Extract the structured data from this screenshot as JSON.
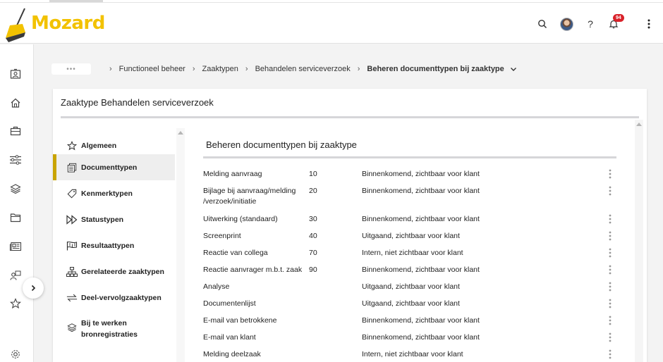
{
  "app": {
    "logo_text": "Mozard",
    "notification_count": "94",
    "help_label": "?"
  },
  "breadcrumb": {
    "more": "•••",
    "items": [
      "Functioneel beheer",
      "Zaaktypen",
      "Behandelen serviceverzoek"
    ],
    "current": "Beheren documenttypen bij zaaktype"
  },
  "card": {
    "title": "Zaaktype Behandelen serviceverzoek"
  },
  "nav": {
    "items": [
      {
        "label": "Algemeen",
        "icon": "star-icon"
      },
      {
        "label": "Documenttypen",
        "icon": "documents-icon",
        "active": true
      },
      {
        "label": "Kenmerktypen",
        "icon": "tag-icon"
      },
      {
        "label": "Statustypen",
        "icon": "fast-forward-icon"
      },
      {
        "label": "Resultaattypen",
        "icon": "flag-icon"
      },
      {
        "label": "Gerelateerde zaaktypen",
        "icon": "hierarchy-icon"
      },
      {
        "label": "Deel-vervolgzaaktypen",
        "icon": "exchange-icon"
      },
      {
        "label": "Bij te werken\nbronregistraties",
        "icon": "layers-icon"
      }
    ]
  },
  "section": {
    "title": "Beheren documenttypen bij zaaktype"
  },
  "documents": [
    {
      "name": "Melding aanvraag",
      "code": "10",
      "type": "Binnenkomend, zichtbaar voor klant"
    },
    {
      "name": "Bijlage bij aanvraag/melding\n/verzoek/initiatie",
      "code": "20",
      "type": "Binnenkomend, zichtbaar voor klant"
    },
    {
      "name": "Uitwerking (standaard)",
      "code": "30",
      "type": "Binnenkomend, zichtbaar voor klant"
    },
    {
      "name": "Screenprint",
      "code": "40",
      "type": "Uitgaand, zichtbaar voor klant"
    },
    {
      "name": "Reactie van collega",
      "code": "70",
      "type": "Intern, niet zichtbaar voor klant"
    },
    {
      "name": "Reactie aanvrager m.b.t. zaak",
      "code": "90",
      "type": "Binnenkomend, zichtbaar voor klant"
    },
    {
      "name": "Analyse",
      "code": "",
      "type": "Uitgaand, zichtbaar voor klant"
    },
    {
      "name": "Documentenlijst",
      "code": "",
      "type": "Uitgaand, zichtbaar voor klant"
    },
    {
      "name": "E-mail van betrokkene",
      "code": "",
      "type": "Binnenkomend, zichtbaar voor klant"
    },
    {
      "name": "E-mail van klant",
      "code": "",
      "type": "Binnenkomend, zichtbaar voor klant"
    },
    {
      "name": "Melding deelzaak",
      "code": "",
      "type": "Intern, niet zichtbaar voor klant"
    }
  ],
  "colors": {
    "brand": "#f2c200",
    "active_marker": "#c9a400",
    "badge": "#d9222a"
  }
}
